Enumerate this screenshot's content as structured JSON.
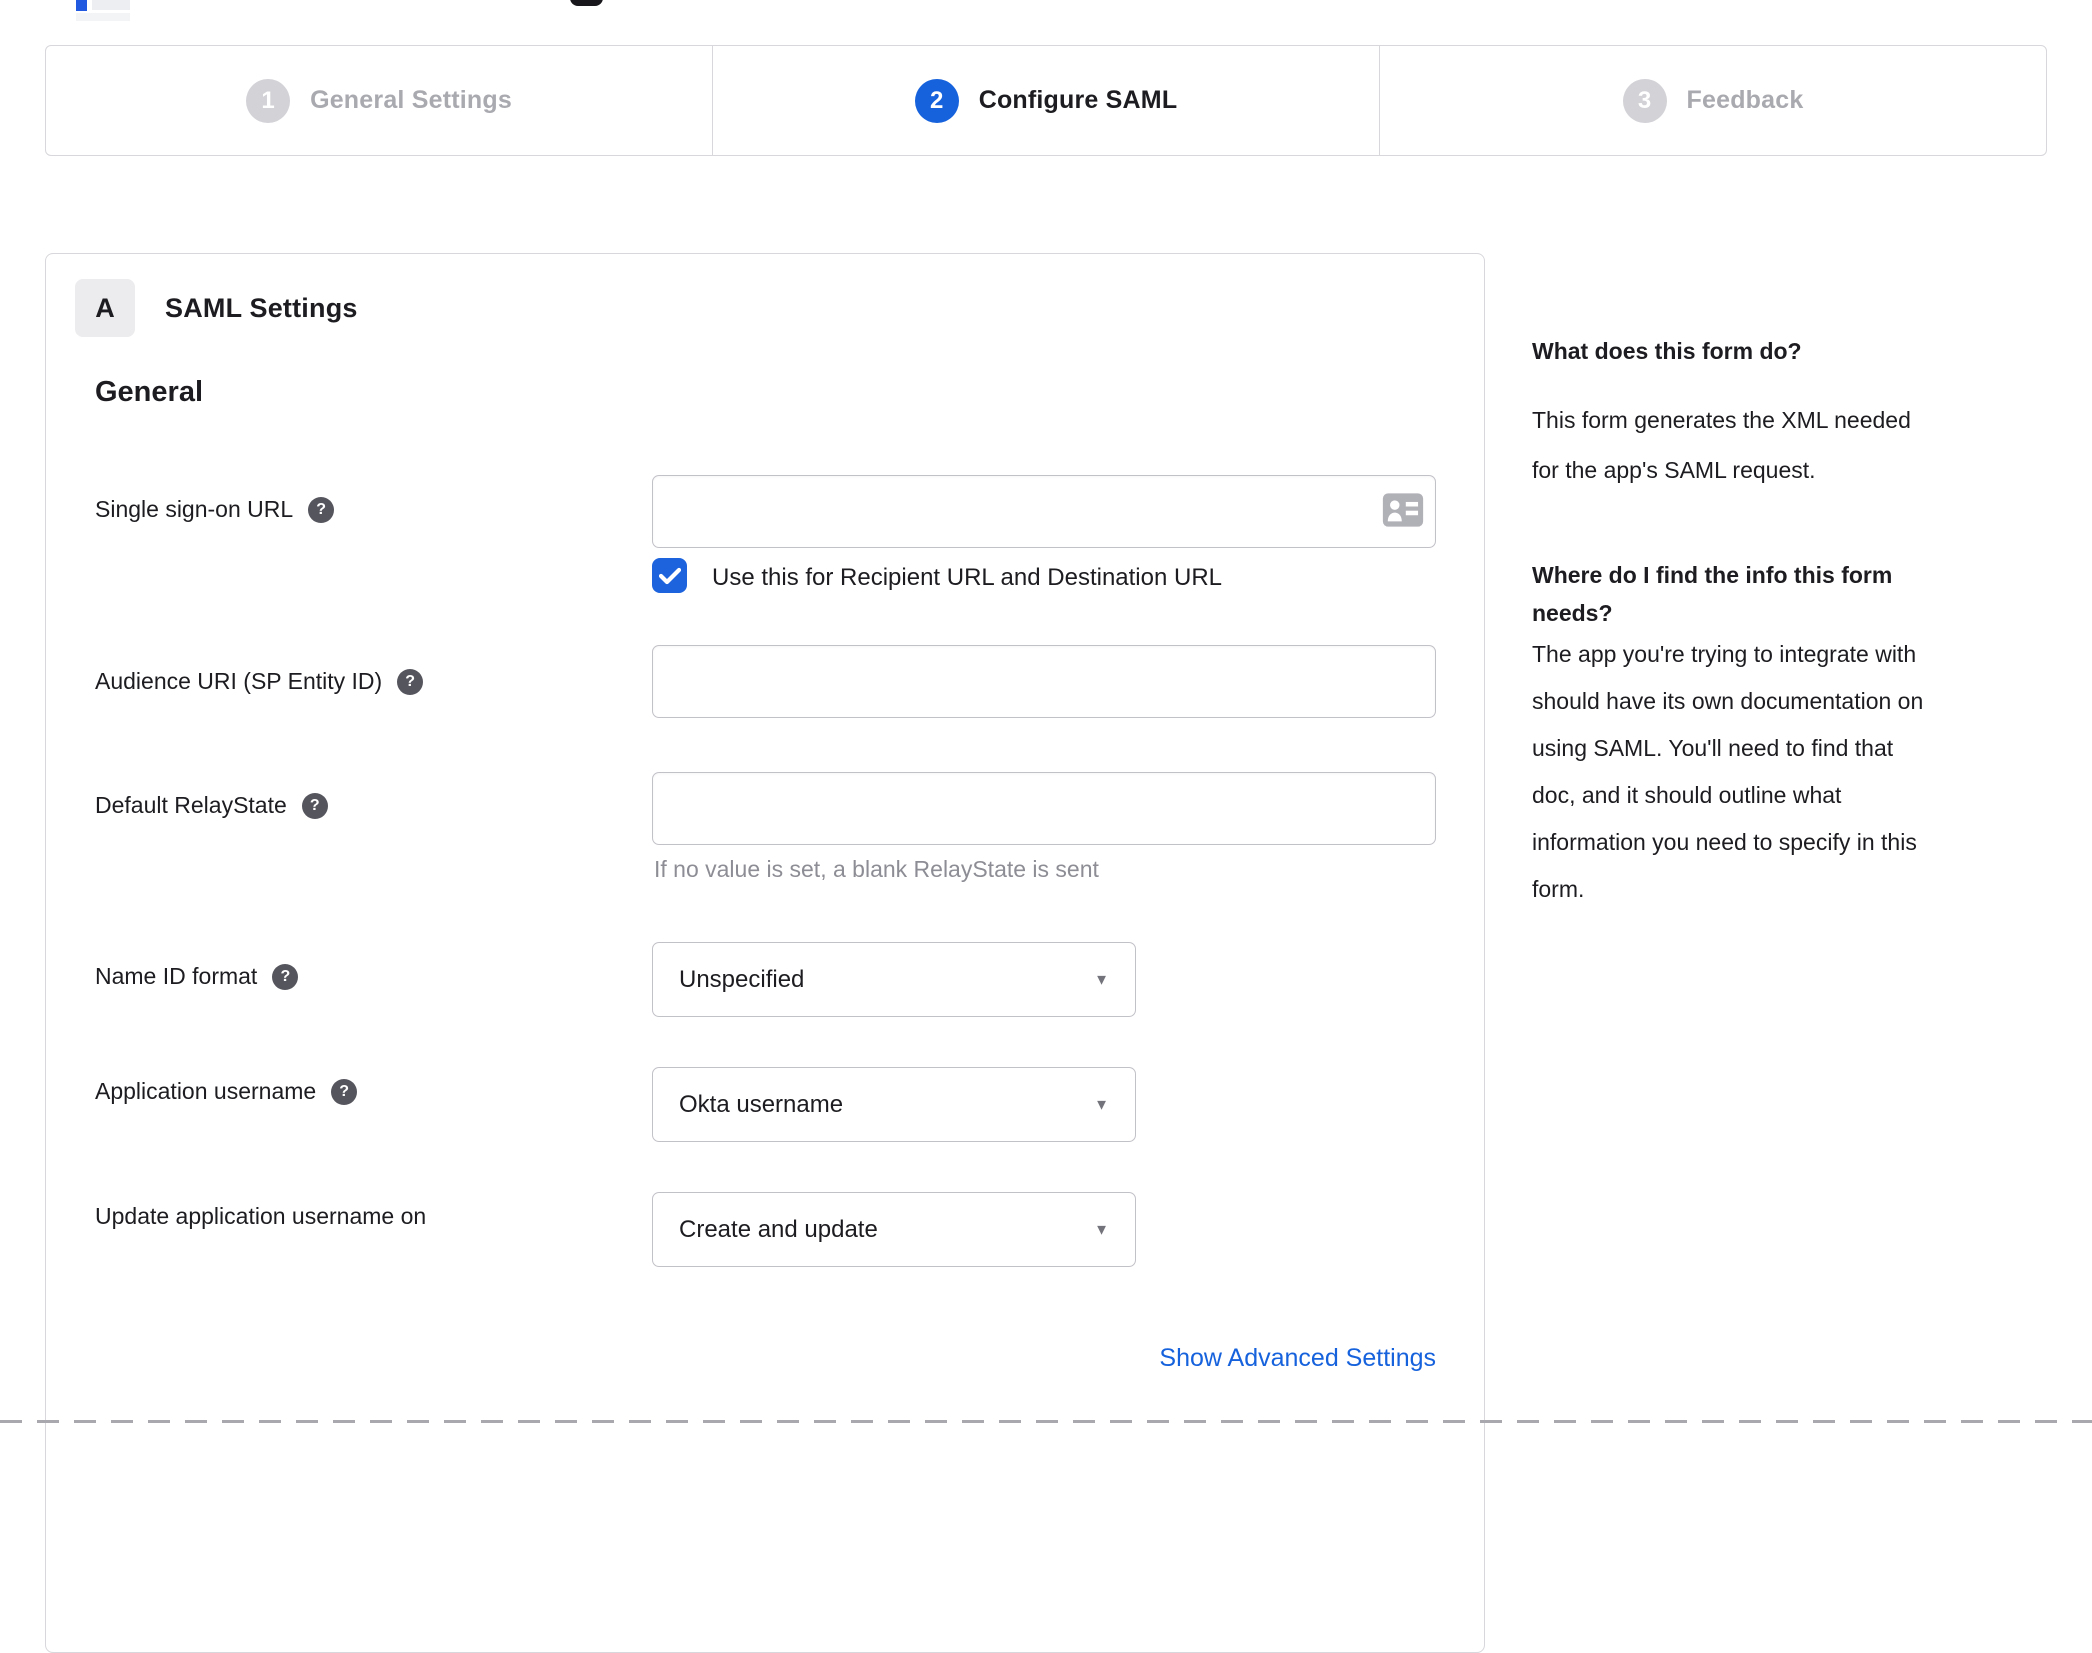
{
  "colors": {
    "accent_blue": "#1662dd",
    "checkbox_blue": "#1c63dd",
    "step_inactive_circle": "#d2d2d7",
    "step_inactive_label": "#a9a9b0",
    "panel_border": "#d7d7dc",
    "input_border": "#c1c1c8",
    "text_primary": "#1d1d21",
    "text_muted": "#8d8d95",
    "help_icon_bg": "#55555e",
    "badge_bg": "#ececee"
  },
  "stepper": {
    "steps": [
      {
        "number": "1",
        "label": "General Settings",
        "state": "inactive"
      },
      {
        "number": "2",
        "label": "Configure SAML",
        "state": "active"
      },
      {
        "number": "3",
        "label": "Feedback",
        "state": "inactive"
      }
    ]
  },
  "panel": {
    "badge": "A",
    "title": "SAML Settings",
    "section_heading": "General",
    "fields": [
      {
        "label": "Single sign-on URL",
        "has_help": true,
        "type": "text",
        "value": "",
        "icon": "contact-card-icon",
        "checkbox": {
          "checked": true,
          "label": "Use this for Recipient URL and Destination URL"
        }
      },
      {
        "label": "Audience URI (SP Entity ID)",
        "has_help": true,
        "type": "text",
        "value": ""
      },
      {
        "label": "Default RelayState",
        "has_help": true,
        "type": "text",
        "value": "",
        "hint": "If no value is set, a blank RelayState is sent"
      },
      {
        "label": "Name ID format",
        "has_help": true,
        "type": "select",
        "value": "Unspecified"
      },
      {
        "label": "Application username",
        "has_help": true,
        "type": "select",
        "value": "Okta username"
      },
      {
        "label": "Update application username on",
        "has_help": false,
        "type": "select",
        "value": "Create and update"
      }
    ],
    "advanced_link": "Show Advanced Settings"
  },
  "sidebar": {
    "heading1": "What does this form do?",
    "p1_lines": [
      "This form generates the XML needed",
      "for the app's SAML request."
    ],
    "heading2_lines": [
      "Where do I find the info this form",
      "needs?"
    ],
    "p2_lines": [
      "The app you're trying to integrate with",
      "should have its own documentation on",
      "using SAML. You'll need to find that",
      "doc, and it should outline what",
      "information you need to specify in this",
      "form."
    ]
  }
}
